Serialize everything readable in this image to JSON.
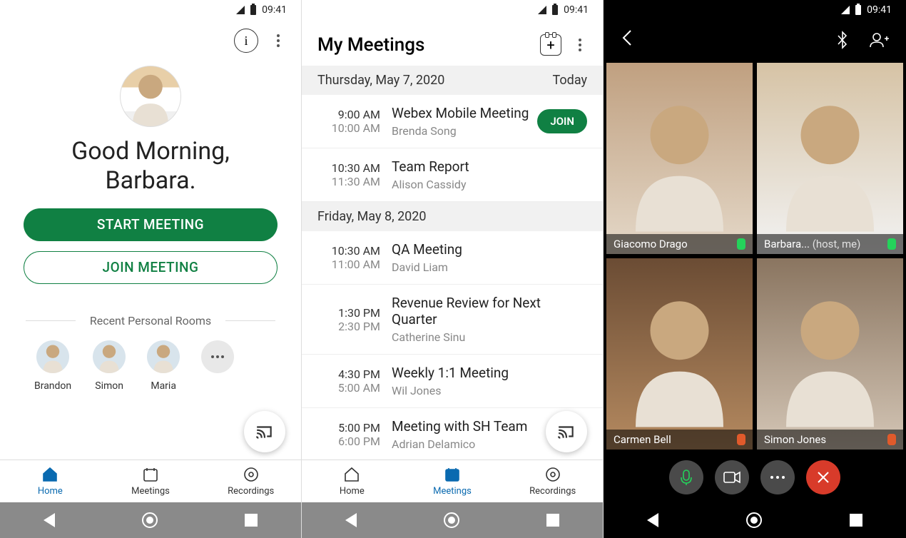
{
  "status": {
    "time": "09:41"
  },
  "home": {
    "greeting_line1": "Good Morning,",
    "greeting_line2": "Barbara.",
    "start_label": "START MEETING",
    "join_label": "JOIN MEETING",
    "recent_header": "Recent Personal Rooms",
    "recents": [
      {
        "name": "Brandon"
      },
      {
        "name": "Simon"
      },
      {
        "name": "Maria"
      }
    ],
    "tabs": {
      "home": "Home",
      "meetings": "Meetings",
      "recordings": "Recordings"
    }
  },
  "meetings": {
    "title": "My Meetings",
    "days": [
      {
        "label": "Thursday, May 7, 2020",
        "badge": "Today",
        "items": [
          {
            "start": "9:00 AM",
            "end": "10:00 AM",
            "title": "Webex Mobile Meeting",
            "host": "Brenda Song",
            "join": "JOIN"
          },
          {
            "start": "10:30 AM",
            "end": "11:30 AM",
            "title": "Team Report",
            "host": "Alison Cassidy"
          }
        ]
      },
      {
        "label": "Friday, May 8, 2020",
        "badge": "",
        "items": [
          {
            "start": "10:30 AM",
            "end": "11:00 AM",
            "title": "QA Meeting",
            "host": "David Liam"
          },
          {
            "start": "1:30 PM",
            "end": "2:30 PM",
            "title": "Revenue Review for Next Quarter",
            "host": "Catherine Sinu"
          },
          {
            "start": "4:30 PM",
            "end": "5:00 AM",
            "title": "Weekly 1:1 Meeting",
            "host": "Wil Jones"
          },
          {
            "start": "5:00 PM",
            "end": "6:00 PM",
            "title": "Meeting with SH Team",
            "host": "Adrian Delamico"
          }
        ]
      }
    ]
  },
  "call": {
    "participants": [
      {
        "name": "Giacomo Drago",
        "mic": "on"
      },
      {
        "name": "Barbara...",
        "suffix": "(host, me)",
        "mic": "on"
      },
      {
        "name": "Carmen Bell",
        "mic": "off"
      },
      {
        "name": "Simon Jones",
        "mic": "off"
      }
    ]
  }
}
